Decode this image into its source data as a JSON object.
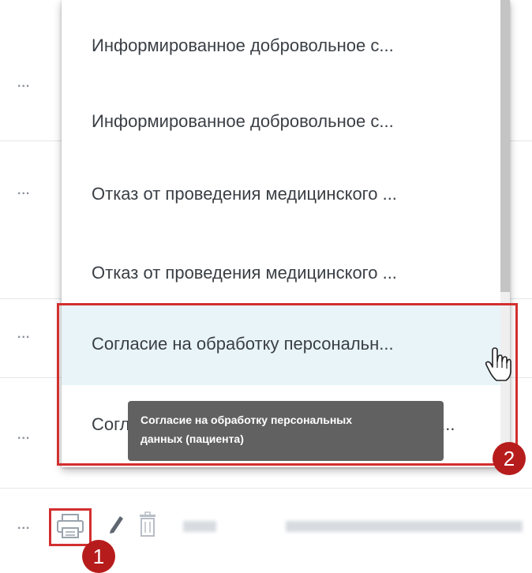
{
  "table": {
    "row_action_label": "..."
  },
  "dropdown": {
    "items": [
      {
        "label": "Информированное добровольное с..."
      },
      {
        "label": "Информированное добровольное с..."
      },
      {
        "label": "Отказ от проведения медицинского ..."
      },
      {
        "label": "Отказ от проведения медицинского ..."
      },
      {
        "label": "Согласие на обработку персональн..."
      },
      {
        "label": "Согл"
      },
      {
        "label": "н..."
      }
    ]
  },
  "tooltip": {
    "line1": "Согласие на обработку персональных",
    "line2": "данных (пациента)"
  },
  "markers": {
    "badge1": "1",
    "badge2": "2"
  },
  "colors": {
    "highlight_border": "#d32f2f",
    "badge_bg": "#b71c1c",
    "hover_row": "#e8f4f8",
    "tooltip_bg": "#616161"
  },
  "icons": [
    "more-horizontal-icon",
    "print-icon",
    "edit-pencil-icon",
    "delete-trash-icon",
    "hand-pointer-cursor-icon"
  ]
}
